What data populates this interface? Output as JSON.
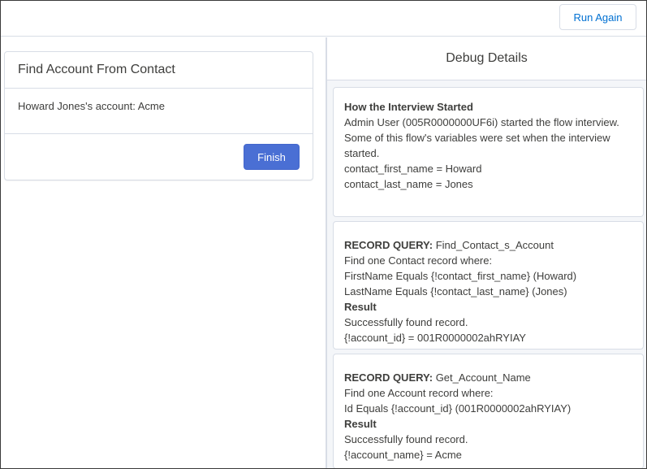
{
  "header": {
    "run_again_label": "Run Again"
  },
  "screen": {
    "title": "Find Account From Contact",
    "body_text": "Howard Jones's account: Acme",
    "finish_label": "Finish"
  },
  "debug": {
    "title": "Debug Details",
    "start": {
      "heading": "How the Interview Started",
      "line1": "Admin User (005R0000000UF6i) started the flow interview.",
      "line2": "Some of this flow's variables were set when the interview started.",
      "var1": "contact_first_name = Howard",
      "var2": "contact_last_name = Jones"
    },
    "query1": {
      "label": "RECORD QUERY:",
      "name": "Find_Contact_s_Account",
      "line1": "Find one Contact record where:",
      "line2": "FirstName Equals {!contact_first_name} (Howard)",
      "line3": "LastName Equals {!contact_last_name} (Jones)",
      "result_heading": "Result",
      "result_line1": "Successfully found record.",
      "result_line2": "{!account_id} = 001R0000002ahRYIAY"
    },
    "query2": {
      "label": "RECORD QUERY:",
      "name": "Get_Account_Name",
      "line1": "Find one Account record where:",
      "line2": "Id Equals {!account_id} (001R0000002ahRYIAY)",
      "result_heading": "Result",
      "result_line1": "Successfully found record.",
      "result_line2": "{!account_name} = Acme"
    }
  }
}
